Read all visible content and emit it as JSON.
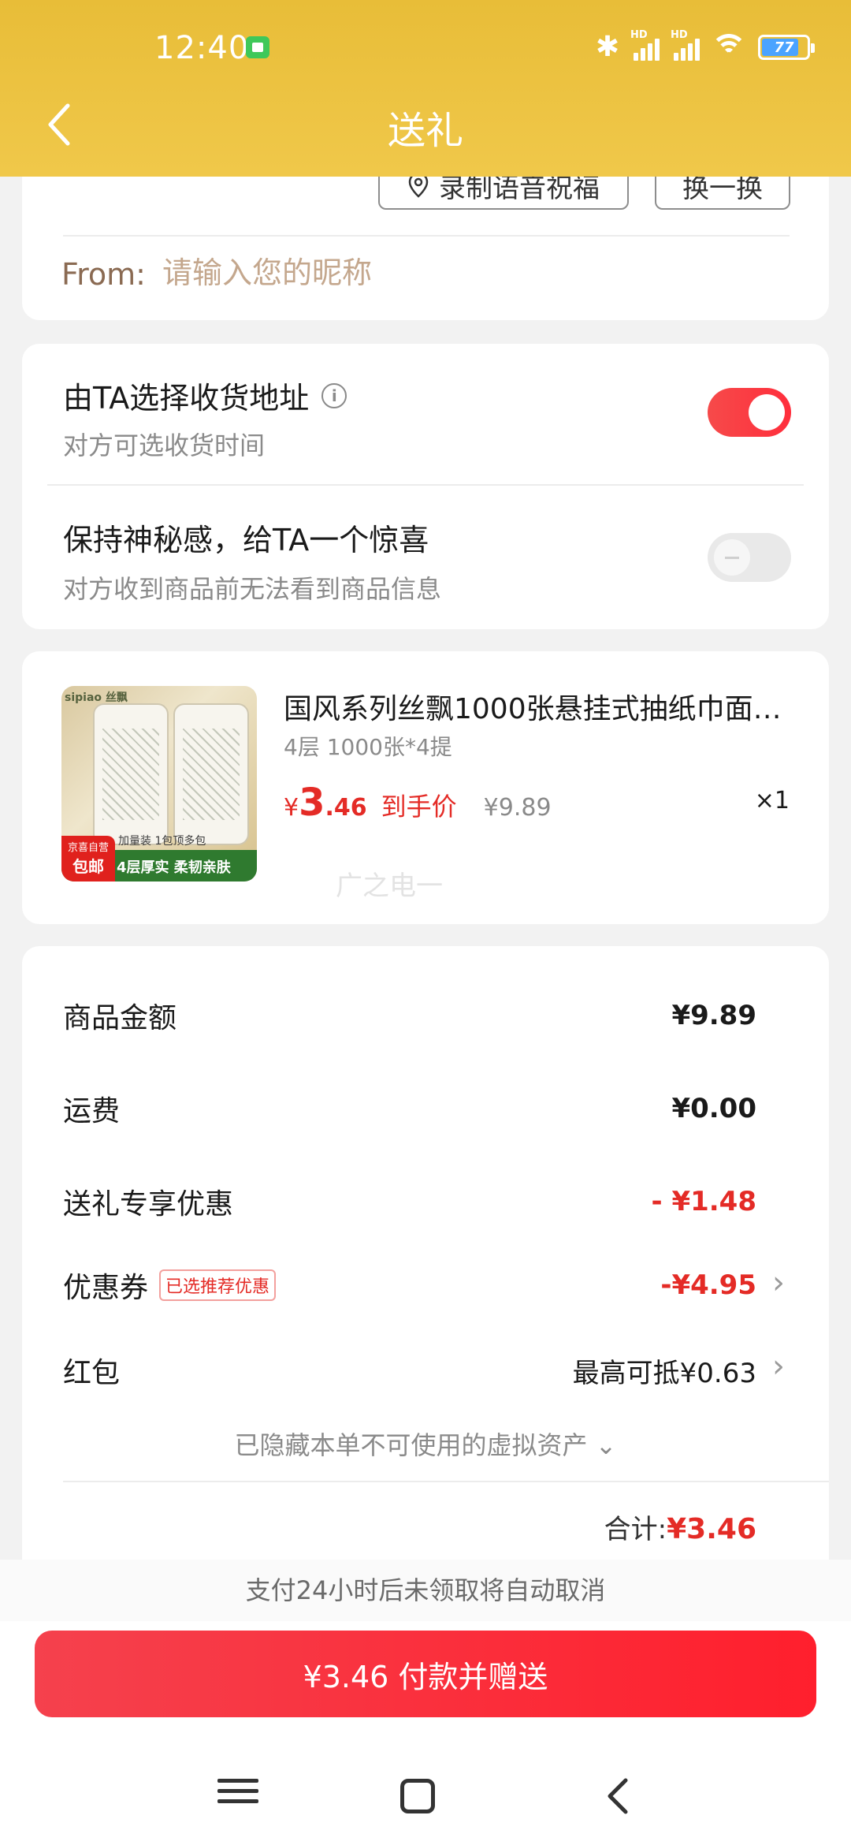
{
  "status": {
    "time": "12:40",
    "battery": "77",
    "hd": "HD"
  },
  "header": {
    "title": "送礼"
  },
  "greeting": {
    "voice_button": "录制语音祝福",
    "swap_button": "换一换",
    "from_label": "From:",
    "from_placeholder": "请输入您的昵称"
  },
  "options": {
    "recipient_address": {
      "title": "由TA选择收货地址",
      "subtitle": "对方可选收货时间",
      "enabled": true
    },
    "mystery": {
      "title": "保持神秘感，给TA一个惊喜",
      "subtitle": "对方收到商品前无法看到商品信息",
      "enabled": false
    }
  },
  "product": {
    "name": "国风系列丝飘1000张悬挂式抽纸巾面…",
    "spec": "4层 1000张*4提",
    "price_currency": "¥",
    "price_int": "3",
    "price_dec": ".46",
    "price_label": "到手价",
    "original_price": "¥9.89",
    "quantity": "×1",
    "image": {
      "brand": "sipiao 丝飘",
      "tag_top": "京喜自营",
      "tag_bottom": "包邮",
      "promo": "加量装 1包顶多包",
      "strip": "4层厚实 柔韧亲肤"
    },
    "watermark": "广之电一"
  },
  "summary": {
    "goods_amount_label": "商品金额",
    "goods_amount": "¥9.89",
    "shipping_label": "运费",
    "shipping": "¥0.00",
    "gift_discount_label": "送礼专享优惠",
    "gift_discount": "- ¥1.48",
    "coupon_label": "优惠券",
    "coupon_badge": "已选推荐优惠",
    "coupon_value": "-¥4.95",
    "redpacket_label": "红包",
    "redpacket_value": "最高可抵¥0.63",
    "hidden_assets": "已隐藏本单不可使用的虚拟资产 ⌄",
    "total_label": "合计:",
    "total_value": "¥3.46"
  },
  "footer": {
    "notice": "支付24小时后未领取将自动取消",
    "pay_button": "¥3.46 付款并赠送"
  },
  "colors": {
    "header_bg": "#f0c84a",
    "accent_red": "#e42b26",
    "button_red": "#ff1f2d"
  }
}
